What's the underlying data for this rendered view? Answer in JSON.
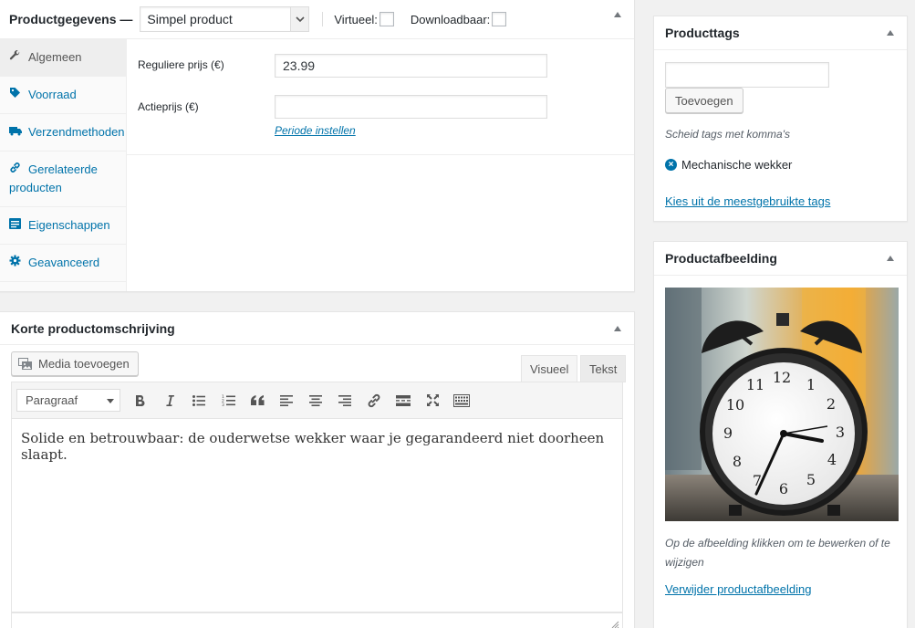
{
  "product_data": {
    "title": "Productgegevens —",
    "type_select": "Simpel product",
    "virtual_label": "Virtueel:",
    "downloadable_label": "Downloadbaar:",
    "tabs": [
      {
        "label": "Algemeen",
        "icon": "wrench-icon",
        "active": true
      },
      {
        "label": "Voorraad",
        "icon": "tag-icon",
        "active": false
      },
      {
        "label": "Verzendmethoden",
        "icon": "truck-icon",
        "active": false
      },
      {
        "label": "Gerelateerde producten",
        "icon": "link-icon",
        "active": false
      },
      {
        "label": "Eigenschappen",
        "icon": "list-icon",
        "active": false
      },
      {
        "label": "Geavanceerd",
        "icon": "gear-icon",
        "active": false
      }
    ],
    "regular_price_label": "Reguliere prijs (€)",
    "regular_price_value": "23.99",
    "sale_price_label": "Actieprijs (€)",
    "sale_price_value": "",
    "schedule_link": "Periode instellen"
  },
  "short_description": {
    "title": "Korte productomschrijving",
    "media_button": "Media toevoegen",
    "tab_visual": "Visueel",
    "tab_text": "Tekst",
    "format_select": "Paragraaf",
    "content": "Solide en betrouwbaar: de ouderwetse wekker waar je gegarandeerd niet doorheen slaapt."
  },
  "product_tags": {
    "title": "Producttags",
    "input_value": "",
    "add_button": "Toevoegen",
    "hint": "Scheid tags met komma's",
    "tags": [
      "Mechanische wekker"
    ],
    "popular_link": "Kies uit de meestgebruikte tags"
  },
  "product_image": {
    "title": "Productafbeelding",
    "hint": "Op de afbeelding klikken om te bewerken of te wijzigen",
    "remove_link": "Verwijder productafbeelding"
  },
  "colors": {
    "link": "#0073aa",
    "text": "#23282d",
    "background": "#f1f1f1"
  }
}
